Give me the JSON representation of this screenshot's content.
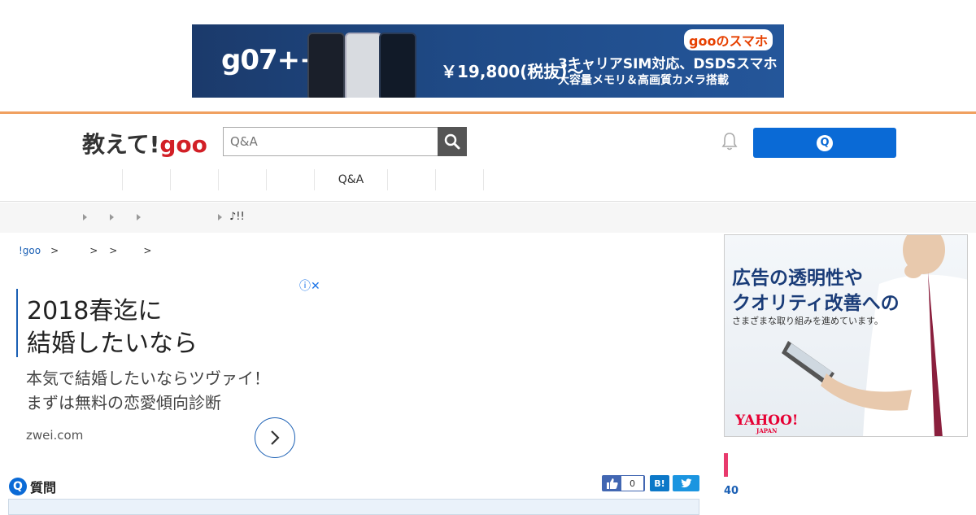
{
  "top_banner": {
    "product": "g07++",
    "price": "￥19,800(税抜)〜",
    "copy_line1": "3キャリアSIM対応、DSDSスマホ",
    "copy_line2": "大容量メモリ＆高画質カメラ搭載",
    "brand": "gooのスマホ"
  },
  "header": {
    "logo_prefix": "教えて!",
    "logo_brand": "goo",
    "search_placeholder": "Q&A",
    "ask_icon": "Q",
    "nav": [
      "",
      "",
      "",
      "",
      "",
      "Q&A",
      "",
      ""
    ]
  },
  "subbar": {
    "text": "♪!!"
  },
  "breadcrumb": {
    "home": "!goo",
    "separators": [
      ">",
      ">",
      ">",
      ">"
    ]
  },
  "ad": {
    "info_icons": "ⓘ✕",
    "headline_line1": "2018春迄に",
    "headline_line2": "結婚したいなら",
    "desc_line1": "本気で結婚したいならツヴァイ！",
    "desc_line2": "まずは無料の恋愛傾向診断",
    "domain": "zwei.com"
  },
  "question": {
    "icon_letter": "Q",
    "label": "質問",
    "like_count": "0",
    "hatena_label": "B!"
  },
  "side_ad": {
    "line1": "広告の透明性や",
    "line2": "クオリティ改善への",
    "line3": "さまざまな取り組みを進めています。",
    "brand": "YAHOO!",
    "brand_sub": "JAPAN"
  },
  "side_count": "40",
  "colors": {
    "accent_blue": "#0a6ad6",
    "header_orange": "#f0a060",
    "goo_red": "#d21f26",
    "pink": "#e83a6d"
  }
}
